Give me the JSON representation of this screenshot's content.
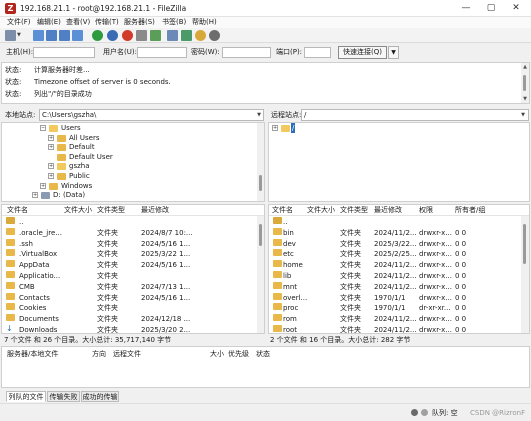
{
  "window": {
    "title": "192.168.21.1 - root@192.168.21.1 - FileZilla",
    "icon_letter": "Z"
  },
  "menu": [
    "文件(F)",
    "编辑(E)",
    "查看(V)",
    "传输(T)",
    "服务器(S)",
    "书签(B)",
    "帮助(H)"
  ],
  "quickconnect": {
    "host_label": "主机(H):",
    "user_label": "用户名(U):",
    "pass_label": "密码(W):",
    "port_label": "端口(P):",
    "host_value": "",
    "user_value": "",
    "pass_value": "",
    "port_value": "",
    "connect_label": "快速连接(Q)"
  },
  "log": [
    {
      "k": "状态:",
      "v": "计算服务器时差..."
    },
    {
      "k": "状态:",
      "v": "Timezone offset of server is 0 seconds."
    },
    {
      "k": "状态:",
      "v": "列出\"/\"的目录成功"
    }
  ],
  "local": {
    "site_label": "本地站点:",
    "path": "C:\\Users\\gszha\\",
    "tree": [
      {
        "name": "Users",
        "level": 1,
        "expander": "−",
        "open": true
      },
      {
        "name": "All Users",
        "level": 2,
        "expander": "+",
        "open": false
      },
      {
        "name": "Default",
        "level": 2,
        "expander": "+",
        "open": false
      },
      {
        "name": "Default User",
        "level": 2,
        "expander": "",
        "open": false
      },
      {
        "name": "gszha",
        "level": 2,
        "expander": "+",
        "open": true
      },
      {
        "name": "Public",
        "level": 2,
        "expander": "+",
        "open": false
      },
      {
        "name": "Windows",
        "level": 1,
        "expander": "+",
        "open": false
      },
      {
        "name": "D: (Data)",
        "level": 0,
        "expander": "+",
        "open": false,
        "drive": true
      }
    ],
    "columns": [
      "文件名",
      "文件大小",
      "文件类型",
      "最近修改"
    ],
    "files": [
      {
        "name": "..",
        "size": "",
        "type": "",
        "modified": "",
        "icon": "up"
      },
      {
        "name": ".oracle_jre...",
        "size": "",
        "type": "文件夹",
        "modified": "2024/8/7 10:...",
        "icon": "folder"
      },
      {
        "name": ".ssh",
        "size": "",
        "type": "文件夹",
        "modified": "2024/5/16 1...",
        "icon": "folder"
      },
      {
        "name": ".VirtualBox",
        "size": "",
        "type": "文件夹",
        "modified": "2025/3/22 1...",
        "icon": "folder"
      },
      {
        "name": "AppData",
        "size": "",
        "type": "文件夹",
        "modified": "2024/5/16 1...",
        "icon": "folder"
      },
      {
        "name": "Applicatio...",
        "size": "",
        "type": "文件夹",
        "modified": "",
        "icon": "folder"
      },
      {
        "name": "CMB",
        "size": "",
        "type": "文件夹",
        "modified": "2024/7/13 1...",
        "icon": "folder"
      },
      {
        "name": "Contacts",
        "size": "",
        "type": "文件夹",
        "modified": "2024/5/16 1...",
        "icon": "folder"
      },
      {
        "name": "Cookies",
        "size": "",
        "type": "文件夹",
        "modified": "",
        "icon": "folder"
      },
      {
        "name": "Documents",
        "size": "",
        "type": "文件夹",
        "modified": "2024/12/18 ...",
        "icon": "folder"
      },
      {
        "name": "Downloads",
        "size": "",
        "type": "文件夹",
        "modified": "2025/3/20 2...",
        "icon": "down"
      }
    ],
    "status": "7 个文件 和 26 个目录。大小总计: 35,717,140 字节"
  },
  "remote": {
    "site_label": "远程站点:",
    "path": "/",
    "tree_root": "/",
    "columns": [
      "文件名",
      "文件大小",
      "文件类型",
      "最近修改",
      "权限",
      "所有者/组"
    ],
    "files": [
      {
        "name": "..",
        "size": "",
        "type": "",
        "modified": "",
        "perm": "",
        "owner": "",
        "icon": "up"
      },
      {
        "name": "bin",
        "size": "",
        "type": "文件夹",
        "modified": "2024/11/2...",
        "perm": "drwxr-x...",
        "owner": "0 0",
        "icon": "folder"
      },
      {
        "name": "dev",
        "size": "",
        "type": "文件夹",
        "modified": "2025/3/22...",
        "perm": "drwxr-x...",
        "owner": "0 0",
        "icon": "folder"
      },
      {
        "name": "etc",
        "size": "",
        "type": "文件夹",
        "modified": "2025/2/25...",
        "perm": "drwxr-x...",
        "owner": "0 0",
        "icon": "folder"
      },
      {
        "name": "home",
        "size": "",
        "type": "文件夹",
        "modified": "2024/11/2...",
        "perm": "drwxr-x...",
        "owner": "0 0",
        "icon": "folder"
      },
      {
        "name": "lib",
        "size": "",
        "type": "文件夹",
        "modified": "2024/11/2...",
        "perm": "drwxr-x...",
        "owner": "0 0",
        "icon": "folder"
      },
      {
        "name": "mnt",
        "size": "",
        "type": "文件夹",
        "modified": "2024/11/2...",
        "perm": "drwxr-x...",
        "owner": "0 0",
        "icon": "folder"
      },
      {
        "name": "overl...",
        "size": "",
        "type": "文件夹",
        "modified": "1970/1/1",
        "perm": "drwxr-x...",
        "owner": "0 0",
        "icon": "folder"
      },
      {
        "name": "proc",
        "size": "",
        "type": "文件夹",
        "modified": "1970/1/1",
        "perm": "dr-xr-xr...",
        "owner": "0 0",
        "icon": "folder"
      },
      {
        "name": "rom",
        "size": "",
        "type": "文件夹",
        "modified": "2024/11/2...",
        "perm": "drwxr-x...",
        "owner": "0 0",
        "icon": "folder"
      },
      {
        "name": "root",
        "size": "",
        "type": "文件夹",
        "modified": "2024/11/2...",
        "perm": "drwxr-x...",
        "owner": "0 0",
        "icon": "folder"
      }
    ],
    "status": "2 个文件 和 16 个目录。大小总计: 282 字节"
  },
  "queue": {
    "columns": [
      "服务器/本地文件",
      "方向",
      "远程文件",
      "大小",
      "优先级",
      "状态"
    ]
  },
  "tabs": [
    "列队的文件",
    "传输失败",
    "成功的传输"
  ],
  "statusbar": {
    "queue": "队列: 空",
    "watermark": "CSDN @RizronF"
  },
  "colors": {
    "folder": "#e8b84a",
    "accent": "#2c6fbd",
    "title_icon": "#b3261e"
  }
}
